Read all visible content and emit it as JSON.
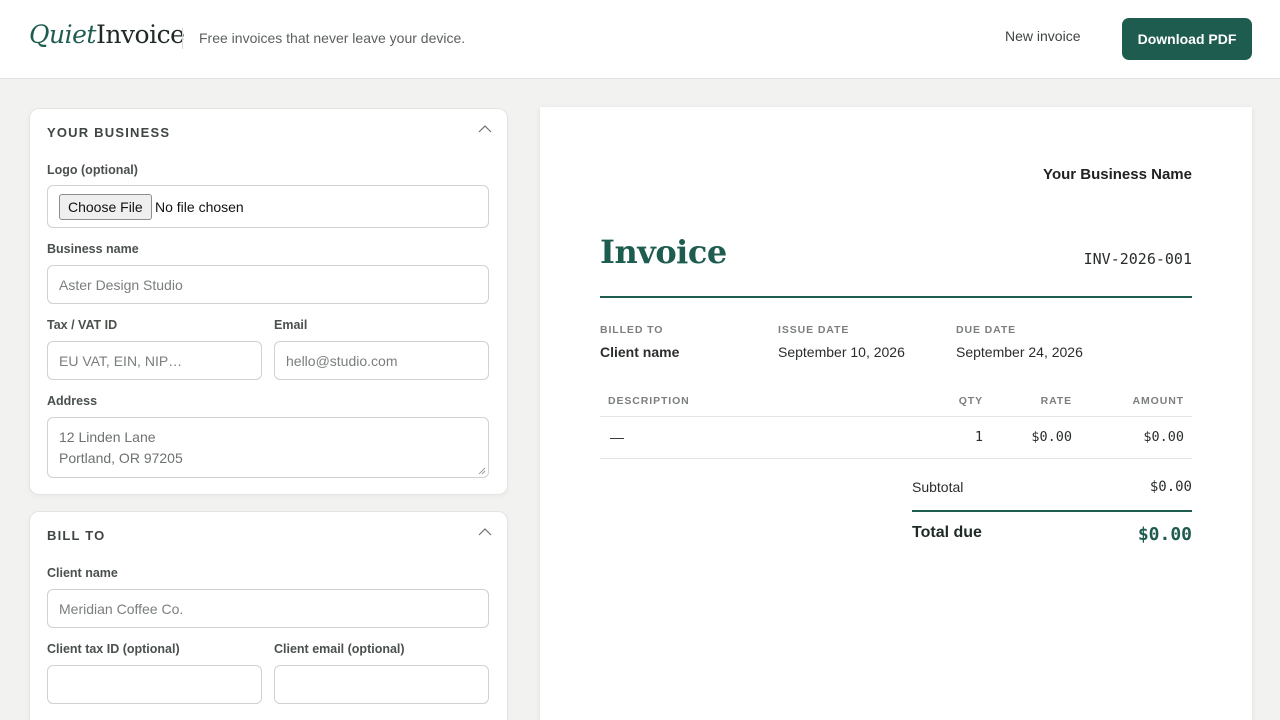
{
  "header": {
    "logo_quiet": "Quiet",
    "logo_invoice": "Invoice",
    "tagline": "Free invoices that never leave your device.",
    "new_invoice": "New invoice",
    "download_pdf": "Download PDF"
  },
  "business": {
    "title": "YOUR BUSINESS",
    "logo_label": "Logo (optional)",
    "choose_file": "Choose File",
    "no_file": "No file chosen",
    "name_label": "Business name",
    "name_placeholder": "Aster Design Studio",
    "tax_label": "Tax / VAT ID",
    "tax_placeholder": "EU VAT, EIN, NIP…",
    "email_label": "Email",
    "email_placeholder": "hello@studio.com",
    "address_label": "Address",
    "address_line1": "12 Linden Lane",
    "address_line2": "Portland, OR 97205"
  },
  "bill_to": {
    "title": "BILL TO",
    "client_label": "Client name",
    "client_placeholder": "Meridian Coffee Co.",
    "client_tax_label": "Client tax ID (optional)",
    "client_email_label": "Client email (optional)"
  },
  "preview": {
    "business_name": "Your Business Name",
    "title": "Invoice",
    "number": "INV-2026-001",
    "billed_to_label": "BILLED TO",
    "billed_to_value": "Client name",
    "issue_date_label": "ISSUE DATE",
    "issue_date": "September 10, 2026",
    "due_date_label": "DUE DATE",
    "due_date": "September 24, 2026",
    "columns": {
      "description": "DESCRIPTION",
      "qty": "QTY",
      "rate": "RATE",
      "amount": "AMOUNT"
    },
    "rows": [
      {
        "description": "—",
        "qty": "1",
        "rate": "$0.00",
        "amount": "$0.00"
      }
    ],
    "subtotal_label": "Subtotal",
    "subtotal": "$0.00",
    "total_label": "Total due",
    "total": "$0.00"
  },
  "colors": {
    "accent": "#1f5c50",
    "background": "#f2f3f1"
  }
}
